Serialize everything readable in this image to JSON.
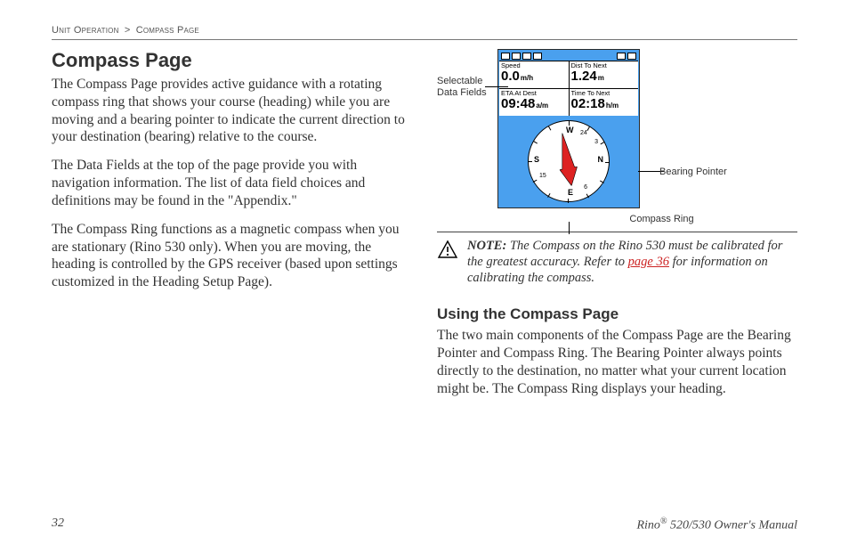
{
  "breadcrumb": {
    "section": "Unit Operation",
    "separator": ">",
    "page": "Compass Page"
  },
  "heading": "Compass Page",
  "paragraphs_left": [
    "The Compass Page provides active guidance with a rotating compass ring that shows your course (heading) while you are moving and a bearing pointer to indicate the current direction to your destination (bearing) relative to the course.",
    "The Data Fields at the top of the page provide you with navigation information. The list of data field choices and definitions may be found in the \"Appendix.\"",
    "The Compass Ring functions as a magnetic compass when you are stationary (Rino 530 only). When you are moving, the heading is controlled by the GPS receiver (based upon settings customized in the Heading Setup Page)."
  ],
  "figure": {
    "label_left": "Selectable Data Fields",
    "label_right": "Bearing Pointer",
    "label_below": "Compass Ring",
    "fields": [
      {
        "label": "Speed",
        "value": "0.0",
        "unit": "m/h"
      },
      {
        "label": "Dist To Next",
        "value": "1.24",
        "unit": "m"
      },
      {
        "label": "ETA At Dest",
        "value": "09:48",
        "unit": "a/m"
      },
      {
        "label": "Time To Next",
        "value": "02:18",
        "unit": "h/m"
      }
    ],
    "cardinals": {
      "n": "N",
      "e": "E",
      "s": "S",
      "w": "W"
    },
    "dial_numbers": {
      "a": "24",
      "b": "15",
      "c": "3",
      "d": "6"
    }
  },
  "note": {
    "label": "NOTE:",
    "text_before": " The Compass on the Rino 530 must be calibrated for the greatest accuracy. Refer to ",
    "link": "page 36",
    "text_after": " for information on calibrating the compass."
  },
  "subheading": "Using the Compass Page",
  "paragraph_right": "The two main components of the Compass Page are the Bearing Pointer and Compass Ring. The Bearing Pointer always points directly to the destination, no matter what your current location might be. The Compass Ring displays your heading.",
  "footer": {
    "page_number": "32",
    "product": "Rino",
    "reg": "®",
    "suffix": " 520/530 Owner's Manual"
  }
}
